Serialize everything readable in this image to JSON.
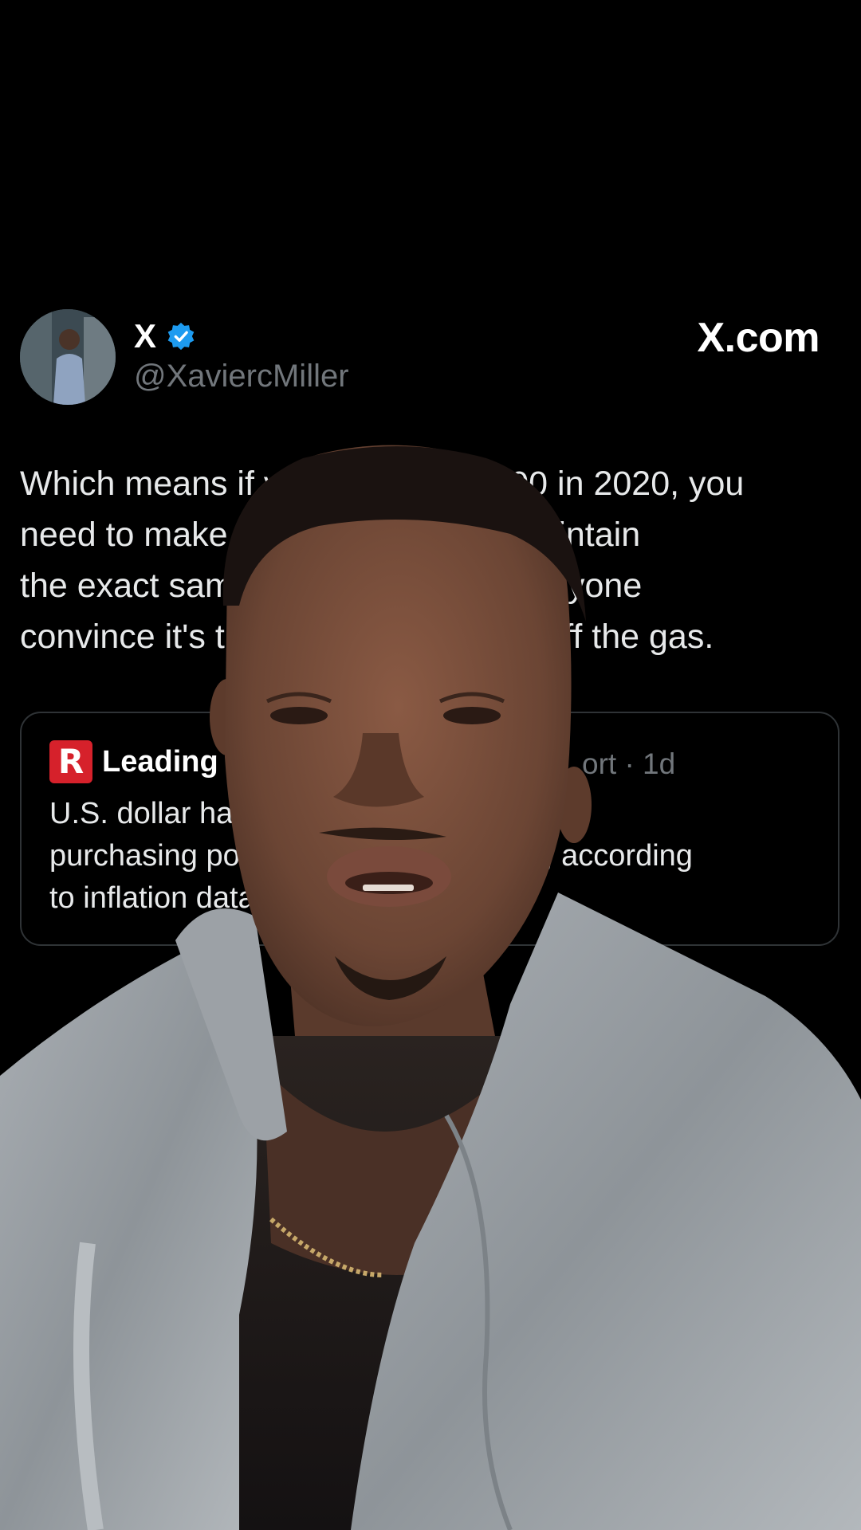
{
  "author": {
    "display_name": "X",
    "handle": "@XaviercMiller",
    "verified_icon": "verified-badge-icon",
    "avatar_icon": "person-avatar"
  },
  "site_label": "X.com",
  "tweet": {
    "lines": [
      "Which means if you made $80,000 in 2020, you",
      "need to make $100,000+ just to maintain",
      "the exact same lifestyle. Don't let anyone",
      "convince it's time to take your foot off the gas."
    ]
  },
  "quote": {
    "logo_letter": "R",
    "source": "Leading Report",
    "meta": "ort · 1d",
    "lines": [
      "U.S. dollar has lost about 20% of its",
      "purchasing power in the past 5 years, according",
      "to inflation data."
    ]
  },
  "overlay": {
    "presenter": "person-speaking-to-camera",
    "colors": {
      "background": "#000000",
      "hoodie": "#9aa0a6",
      "skin": "#6b4534"
    }
  }
}
